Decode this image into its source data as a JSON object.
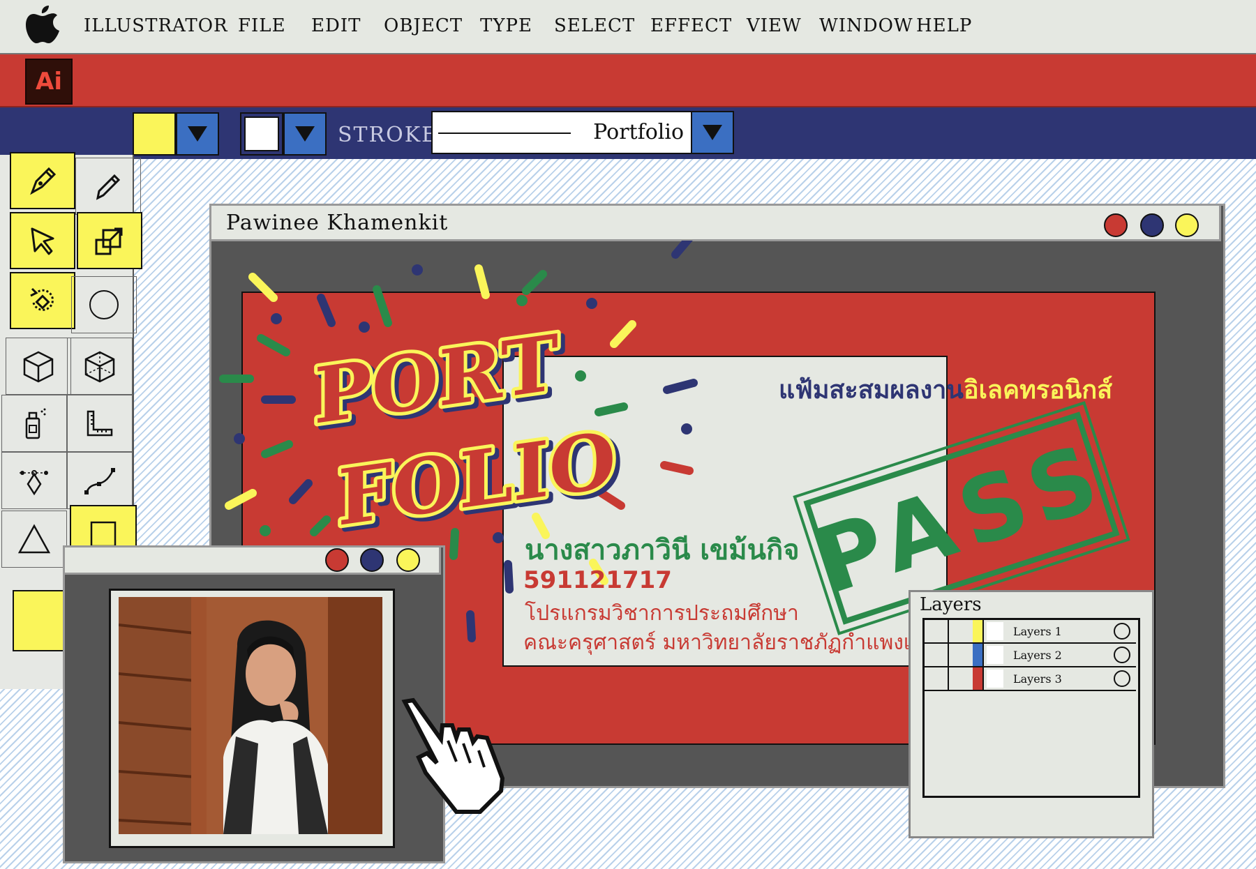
{
  "menubar": {
    "apple_icon": "apple-logo-icon",
    "items": [
      "ILLUSTRATOR",
      "FILE",
      "EDIT",
      "OBJECT",
      "TYPE",
      "SELECT",
      "EFFECT",
      "VIEW",
      "WINDOW",
      "HELP"
    ]
  },
  "appbar": {
    "logo": "Ai"
  },
  "controlbar": {
    "fill_color": "#faf55a",
    "stroke_color": "#ffffff",
    "stroke_label": "STROKE",
    "brush_value": "Portfolio"
  },
  "main_window": {
    "title": "Pawinee Khamenkit",
    "art_line1": "PORT",
    "art_line2": "FOLIO",
    "thai_title_main": "แฟ้มสะสมผลงาน",
    "thai_title_tail": "อิเลคทรอนิกส์",
    "name": "นางสาวภาวินี เขม้นกิจ",
    "student_id": "591121717",
    "program": "โปรแกรมวิชาการประถมศึกษา",
    "faculty": "คณะครุศาสตร์ มหาวิทยาลัยราชภัฏกำแพงเพชร",
    "stamp": "PASS"
  },
  "layers": {
    "title": "Layers",
    "items": [
      {
        "label": "Layers 1",
        "color": "#faf55a"
      },
      {
        "label": "Layers 2",
        "color": "#3b6fc2"
      },
      {
        "label": "Layers 3",
        "color": "#c83a33"
      }
    ]
  },
  "colors": {
    "red": "#c83a33",
    "navy": "#2e3573",
    "yellow": "#faf55a",
    "green": "#2a8a4a",
    "blue": "#3b6fc2"
  }
}
